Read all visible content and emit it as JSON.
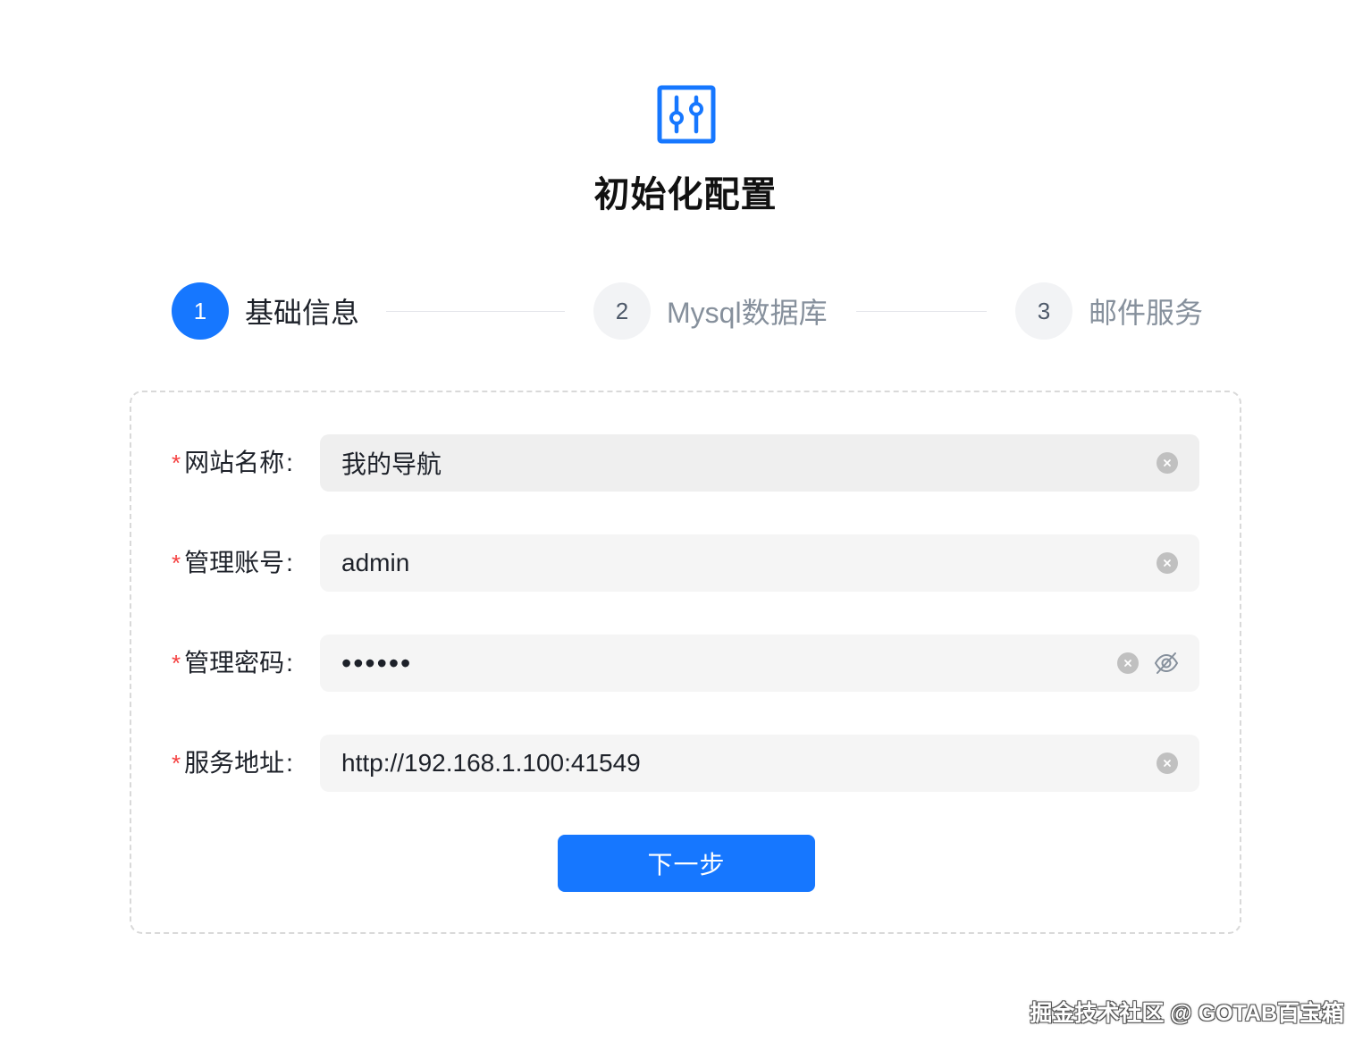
{
  "logo": {
    "icon": "settings-sliders-icon",
    "color": "#1677ff"
  },
  "page": {
    "title": "初始化配置"
  },
  "steps": [
    {
      "number": "1",
      "label": "基础信息",
      "active": true
    },
    {
      "number": "2",
      "label": "Mysql数据库",
      "active": false
    },
    {
      "number": "3",
      "label": "邮件服务",
      "active": false
    }
  ],
  "form": {
    "required_mark": "*",
    "colon": ":",
    "site_name": {
      "label": "网站名称",
      "value": "我的导航"
    },
    "admin_account": {
      "label": "管理账号",
      "value": "admin"
    },
    "admin_password": {
      "label": "管理密码",
      "value": "••••••"
    },
    "service_url": {
      "label": "服务地址",
      "value": "http://192.168.1.100:41549"
    }
  },
  "actions": {
    "next_label": "下一步"
  },
  "watermark": {
    "text": "掘金技术社区 @ GOTAB百宝箱"
  },
  "colors": {
    "primary": "#1677ff",
    "required": "#f53f3f",
    "inactive_step_bg": "#f2f3f5"
  }
}
